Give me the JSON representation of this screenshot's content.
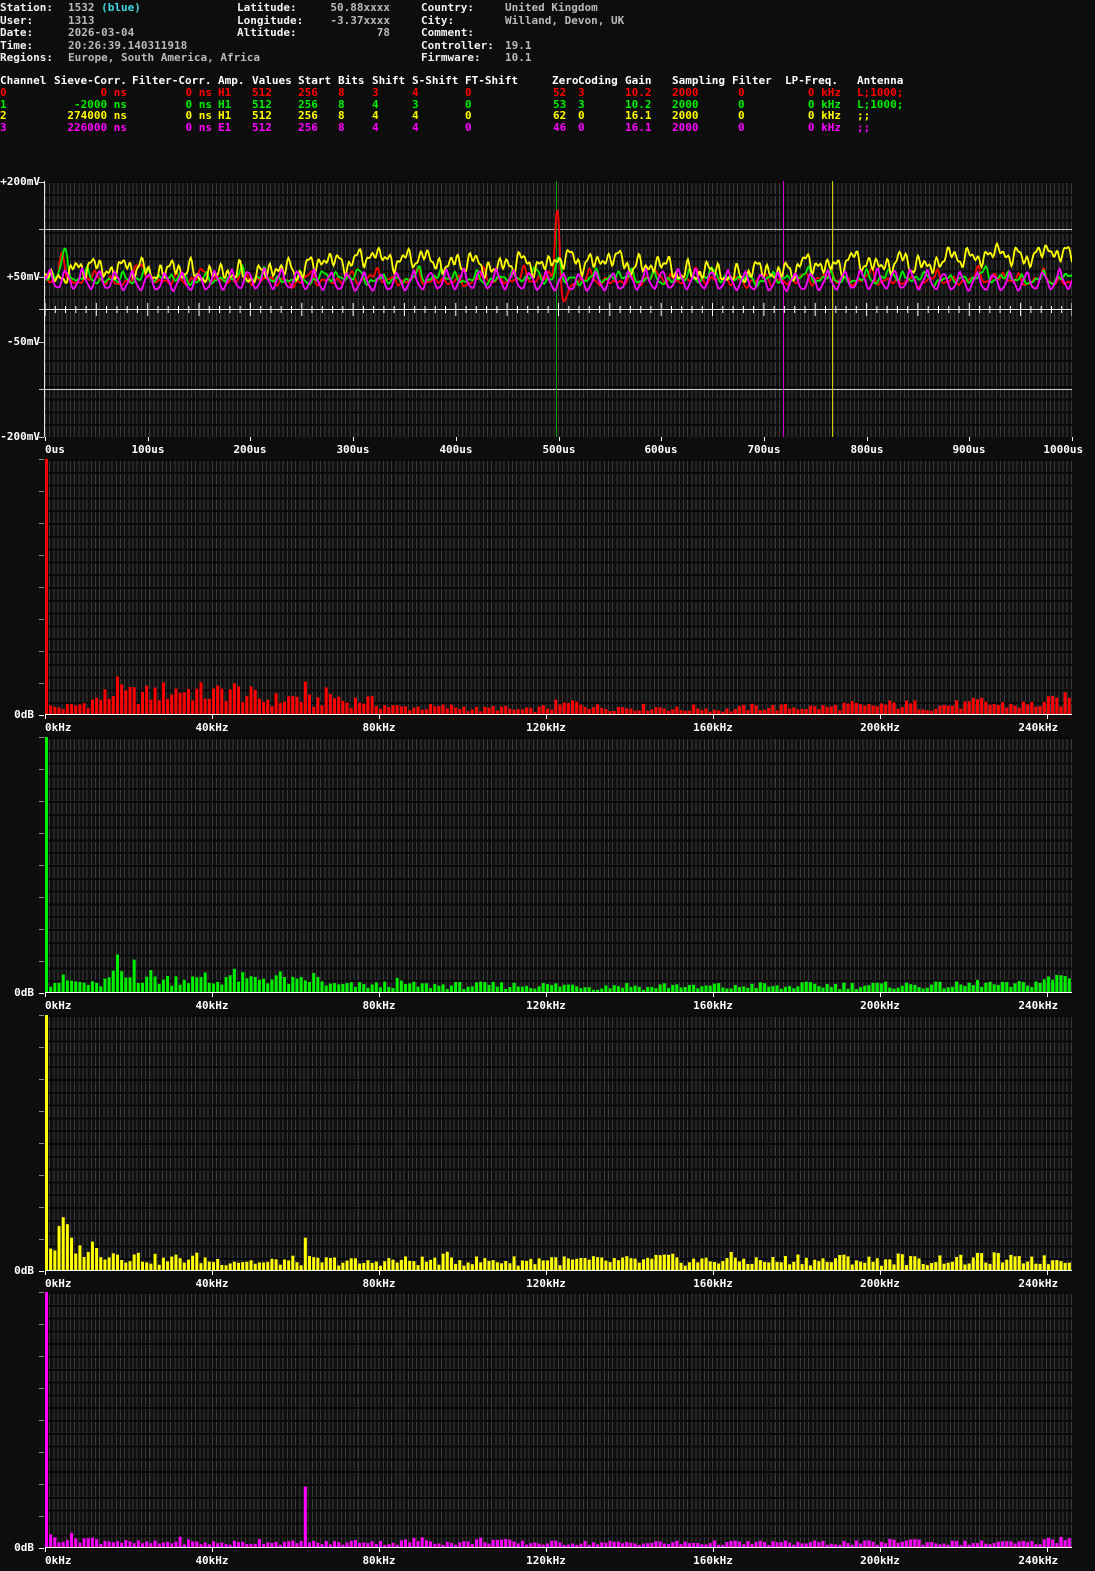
{
  "header": {
    "left": [
      {
        "label": "Station:",
        "value": "1532",
        "extra": "(blue)"
      },
      {
        "label": "User:",
        "value": "1313",
        "extra": ""
      },
      {
        "label": "Date:",
        "value": "2026-03-04",
        "extra": ""
      },
      {
        "label": "Time:",
        "value": "20:26:39.140311918",
        "extra": ""
      },
      {
        "label": "Regions:",
        "value": "Europe, South America, Africa",
        "extra": ""
      }
    ],
    "middle": [
      {
        "label": "Latitude:",
        "value": "50.88xxxx"
      },
      {
        "label": "Longitude:",
        "value": "-3.37xxxx"
      },
      {
        "label": "Altitude:",
        "value": "78"
      }
    ],
    "right": [
      {
        "label": "Country:",
        "value": "United Kingdom"
      },
      {
        "label": "City:",
        "value": "Willand, Devon, UK"
      },
      {
        "label": "Comment:",
        "value": ""
      },
      {
        "label": "Controller:",
        "value": "19.1"
      },
      {
        "label": "Firmware:",
        "value": "10.1"
      }
    ],
    "accent_color": "#3fd9e3"
  },
  "channel_table": {
    "columns": [
      "Channel",
      "Sieve-Corr.",
      "Filter-Corr.",
      "Amp.",
      "Values",
      "Start",
      "Bits",
      "Shift",
      "S-Shift",
      "FT-Shift",
      "Zero",
      "Coding",
      "Gain",
      "Sampling",
      "Filter",
      "LP-Freq.",
      "Antenna"
    ],
    "rows": [
      {
        "color": "#ff0000",
        "cells": [
          "0",
          "0 ns",
          "0 ns",
          "H1",
          "512",
          "256",
          "8",
          "3",
          "4",
          "0",
          "52",
          "3",
          "10.2",
          "2000",
          "0",
          "0 kHz",
          "L;1000;"
        ]
      },
      {
        "color": "#00ee00",
        "cells": [
          "1",
          "-2000 ns",
          "0 ns",
          "H1",
          "512",
          "256",
          "8",
          "4",
          "3",
          "0",
          "53",
          "3",
          "10.2",
          "2000",
          "0",
          "0 kHz",
          "L;1000;"
        ]
      },
      {
        "color": "#ffff00",
        "cells": [
          "2",
          "274000 ns",
          "0 ns",
          "H1",
          "512",
          "256",
          "8",
          "4",
          "4",
          "0",
          "62",
          "0",
          "16.1",
          "2000",
          "0",
          "0 kHz",
          ";;"
        ]
      },
      {
        "color": "#ff00ff",
        "cells": [
          "3",
          "226000 ns",
          "0 ns",
          "E1",
          "512",
          "256",
          "8",
          "4",
          "4",
          "0",
          "46",
          "0",
          "16.1",
          "2000",
          "0",
          "0 kHz",
          ";;"
        ]
      }
    ]
  },
  "chart_data": {
    "scope": {
      "type": "line",
      "x": {
        "unit": "us",
        "min": 0,
        "max": 1000,
        "tick_step_us": 100,
        "tick_labels": [
          "0us",
          "100us",
          "200us",
          "300us",
          "400us",
          "500us",
          "600us",
          "700us",
          "800us",
          "900us",
          "1000us"
        ]
      },
      "y": {
        "unit": "mV",
        "scale": "symlog",
        "labels": [
          {
            "text": "+200mV",
            "mV": 200
          },
          {
            "text": "+50mV",
            "mV": 50
          },
          {
            "text": "-50mV",
            "mV": -50
          },
          {
            "text": "-200mV",
            "mV": -200
          }
        ],
        "ref_lines_mV": [
          100,
          -100
        ],
        "zero_line_mV": 0
      },
      "event_lines": [
        {
          "t_us": 497.5,
          "color": "#00a000"
        },
        {
          "t_us": 718.5,
          "color": "#d400d4"
        },
        {
          "t_us": 766,
          "color": "#c8c800"
        }
      ],
      "channels": [
        {
          "name": "channel-0",
          "color": "#ff0000",
          "base_mV": 45,
          "drift_mV": 0,
          "noise": [
            [
              21,
              4,
              0.5
            ],
            [
              13,
              3.5,
              2.1
            ],
            [
              34,
              3,
              4.2
            ],
            [
              7.9,
              2.5,
              1.3
            ],
            [
              55,
              2,
              3.3
            ],
            [
              150,
              2,
              0.8
            ]
          ],
          "events": [
            [
              499,
              2.8,
              93
            ],
            [
              505.5,
              4,
              -40
            ],
            [
              17,
              4,
              28
            ],
            [
              24,
              5,
              -14
            ],
            [
              96,
              6,
              16
            ]
          ]
        },
        {
          "name": "channel-1",
          "color": "#00ee00",
          "base_mV": 47,
          "drift_mV": 0,
          "noise": [
            [
              19,
              3.5,
              1.0
            ],
            [
              11.5,
              3,
              3.7
            ],
            [
              29,
              3,
              5.1
            ],
            [
              6.9,
              2,
              2.2
            ],
            [
              90,
              2.5,
              0.3
            ]
          ],
          "events": [
            [
              499.5,
              3,
              20
            ],
            [
              19,
              5,
              18
            ]
          ]
        },
        {
          "name": "channel-2",
          "color": "#ffff00",
          "base_mV": 56,
          "drift_mV": 6,
          "noise": [
            [
              16.1,
              3,
              2.5
            ],
            [
              23,
              4,
              0.2
            ],
            [
              9.7,
              3.5,
              4.4
            ],
            [
              5.9,
              3,
              1.1
            ],
            [
              47,
              3,
              3.0
            ],
            [
              230,
              4,
              5.5
            ],
            [
              620,
              5,
              3.9
            ]
          ],
          "events": [
            [
              905,
              40,
              8
            ],
            [
              50,
              15,
              5
            ]
          ]
        },
        {
          "name": "channel-3",
          "color": "#ff00ff",
          "base_mV": 42,
          "drift_mV": 0,
          "noise": [
            [
              16.13,
              11.5,
              0
            ],
            [
              6.1,
              1.5,
              2.0
            ],
            [
              200,
              1.5,
              1.0
            ]
          ],
          "events": []
        }
      ]
    },
    "spectra": [
      {
        "name": "channel-0-spectrum",
        "type": "bar",
        "color": "#ff0000",
        "seed": 1,
        "baseline_label": "0dB",
        "bins_kHz": 246,
        "bin0_pct": 100,
        "x_tick_labels": [
          "0kHz",
          "40kHz",
          "80kHz",
          "120kHz",
          "160kHz",
          "200kHz",
          "240kHz"
        ],
        "envelope_step_kHz": 4,
        "envelope_pct": [
          3,
          3,
          4,
          6,
          8,
          8,
          8,
          9,
          10,
          9,
          8,
          10,
          8,
          6,
          6,
          7,
          5,
          8,
          5,
          6,
          4,
          3,
          3,
          3,
          3,
          3,
          2,
          3,
          2,
          2,
          3,
          4,
          5,
          3,
          3,
          3,
          3,
          3,
          2,
          3,
          2,
          2,
          3,
          3,
          3,
          3,
          3,
          3,
          4,
          3,
          4,
          4,
          4,
          3,
          4,
          4,
          5,
          4,
          4,
          4,
          5,
          6,
          7
        ],
        "peaks": [
          [
            17,
            15
          ],
          [
            14,
            10
          ],
          [
            62,
            13
          ],
          [
            122,
            6
          ]
        ]
      },
      {
        "name": "channel-1-spectrum",
        "type": "bar",
        "color": "#00ee00",
        "seed": 2,
        "baseline_label": "0dB",
        "bins_kHz": 246,
        "bin0_pct": 100,
        "x_tick_labels": [
          "0kHz",
          "40kHz",
          "80kHz",
          "120kHz",
          "160kHz",
          "200kHz",
          "240kHz"
        ],
        "envelope_step_kHz": 4,
        "envelope_pct": [
          4,
          5,
          4,
          3,
          6,
          6,
          7,
          5,
          6,
          5,
          4,
          7,
          5,
          6,
          6,
          4,
          6,
          3,
          3,
          3,
          3,
          4,
          3,
          3,
          3,
          3,
          3,
          3,
          3,
          3,
          3,
          3,
          3,
          2,
          3,
          3,
          2,
          3,
          3,
          2,
          3,
          2,
          3,
          3,
          2,
          3,
          3,
          3,
          3,
          3,
          3,
          3,
          3,
          3,
          3,
          3,
          4,
          3,
          3,
          4,
          5,
          7,
          8
        ],
        "peaks": [
          [
            17,
            15
          ],
          [
            21,
            13
          ],
          [
            38,
            8
          ]
        ]
      },
      {
        "name": "channel-2-spectrum",
        "type": "bar",
        "color": "#ffff00",
        "seed": 3,
        "baseline_label": "0dB",
        "bins_kHz": 246,
        "bin0_pct": 100,
        "x_tick_labels": [
          "0kHz",
          "40kHz",
          "80kHz",
          "120kHz",
          "160kHz",
          "200kHz",
          "240kHz"
        ],
        "envelope_step_kHz": 4,
        "envelope_pct": [
          8,
          14,
          10,
          9,
          7,
          6,
          5,
          4,
          5,
          5,
          4,
          4,
          4,
          3,
          4,
          4,
          4,
          4,
          4,
          3,
          4,
          4,
          4,
          4,
          5,
          4,
          4,
          4,
          4,
          4,
          5,
          4,
          4,
          4,
          4,
          4,
          4,
          5,
          4,
          4,
          4,
          5,
          4,
          4,
          4,
          5,
          4,
          4,
          5,
          4,
          4,
          5,
          4,
          4,
          5,
          4,
          5,
          5,
          4,
          5,
          4,
          5,
          6
        ],
        "peaks": [
          [
            2,
            8
          ],
          [
            4,
            21
          ],
          [
            6,
            13
          ],
          [
            8,
            10
          ],
          [
            12,
            9
          ],
          [
            62,
            13
          ]
        ]
      },
      {
        "name": "channel-3-spectrum",
        "type": "bar",
        "color": "#ff00ff",
        "seed": 4,
        "baseline_label": "0dB",
        "bins_kHz": 246,
        "bin0_pct": 100,
        "x_tick_labels": [
          "0kHz",
          "40kHz",
          "80kHz",
          "120kHz",
          "160kHz",
          "200kHz",
          "240kHz"
        ],
        "envelope_step_kHz": 4,
        "envelope_pct": [
          4,
          4,
          4,
          3,
          3,
          2,
          2,
          2,
          3,
          2,
          2,
          2,
          2,
          3,
          2,
          2,
          2,
          2,
          2,
          3,
          2,
          2,
          3,
          3,
          2,
          2,
          3,
          3,
          2,
          2,
          2,
          2,
          2,
          2,
          2,
          2,
          2,
          2,
          2,
          2,
          2,
          2,
          2,
          2,
          2,
          2,
          2,
          2,
          2,
          2,
          2,
          3,
          3,
          2,
          2,
          2,
          2,
          2,
          2,
          2,
          3,
          4,
          5
        ],
        "peaks": [
          [
            62,
            24
          ]
        ]
      }
    ]
  },
  "layout_text": {
    "note": ""
  }
}
